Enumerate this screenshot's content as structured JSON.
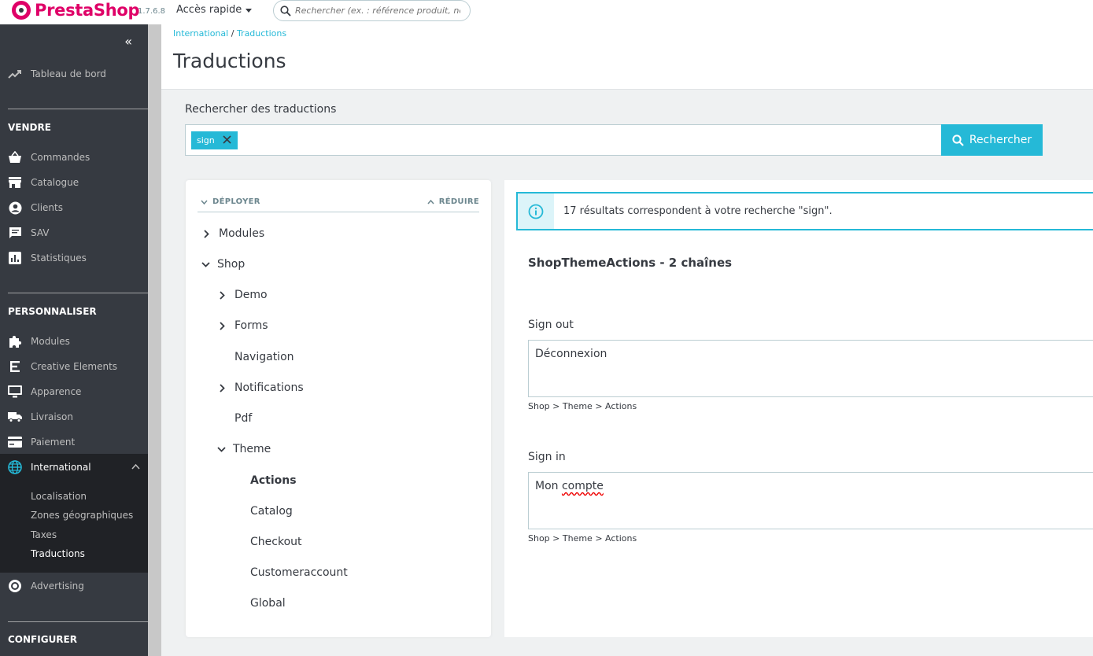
{
  "header": {
    "logo_text": "PrestaShop",
    "version": "1.7.6.8",
    "quick_access": "Accès rapide",
    "search_placeholder": "Rechercher (ex. : référence produit, nom"
  },
  "sidebar": {
    "dashboard": "Tableau de bord",
    "sections": {
      "sell": "VENDRE",
      "customize": "PERSONNALISER",
      "configure": "CONFIGURER"
    },
    "sell_items": [
      "Commandes",
      "Catalogue",
      "Clients",
      "SAV",
      "Statistiques"
    ],
    "customize_items": [
      "Modules",
      "Creative Elements",
      "Apparence",
      "Livraison",
      "Paiement",
      "International"
    ],
    "international_sub": [
      "Localisation",
      "Zones géographiques",
      "Taxes",
      "Traductions"
    ],
    "advertising": "Advertising"
  },
  "breadcrumb": {
    "parent": "International",
    "separator": "/",
    "current": "Traductions"
  },
  "page_title": "Traductions",
  "search": {
    "label": "Rechercher des traductions",
    "tag": "sign",
    "button": "Rechercher"
  },
  "tree": {
    "expand": "DÉPLOYER",
    "reduce": "RÉDUIRE",
    "items": {
      "modules": "Modules",
      "shop": "Shop",
      "demo": "Demo",
      "forms": "Forms",
      "navigation": "Navigation",
      "notifications": "Notifications",
      "pdf": "Pdf",
      "theme": "Theme",
      "actions": "Actions",
      "catalog": "Catalog",
      "checkout": "Checkout",
      "customeraccount": "Customeraccount",
      "global": "Global"
    }
  },
  "results": {
    "alert": "17 résultats correspondent à votre recherche \"sign\".",
    "title": "ShopThemeActions - 2 chaînes",
    "fields": [
      {
        "label": "Sign out",
        "value_a": "Déconnexion",
        "value_b": "",
        "path": "Shop > Theme > Actions"
      },
      {
        "label": "Sign in",
        "value_a": "Mon ",
        "value_b": "compte",
        "path": "Shop > Theme > Actions"
      }
    ]
  },
  "colors": {
    "brand": "#df0067",
    "accent": "#25b9d7",
    "sidebar": "#363a41"
  }
}
